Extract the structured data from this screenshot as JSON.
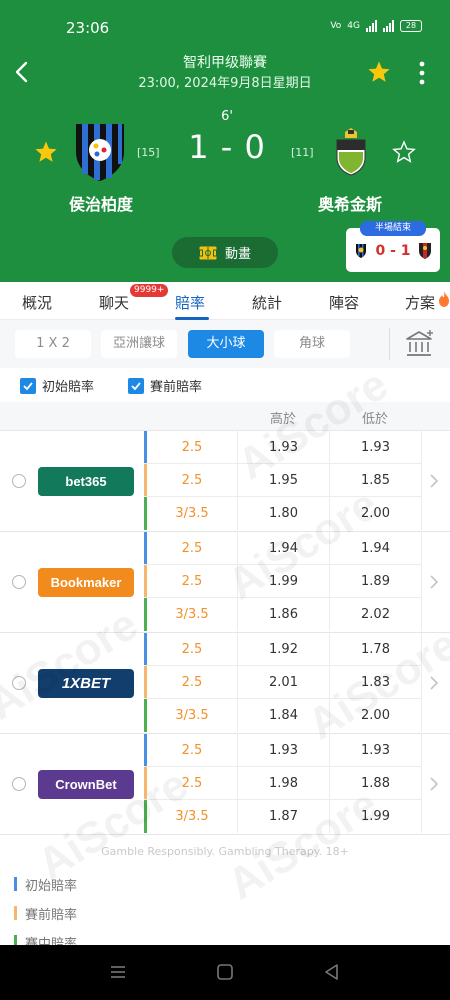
{
  "status_bar": {
    "time": "23:06",
    "network": "4G",
    "battery": "28"
  },
  "match": {
    "league": "智利甲级聯賽",
    "datetime": "23:00, 2024年9月8日星期日",
    "minute": "6'",
    "score": "1 - 0",
    "home": {
      "name": "侯治柏度",
      "rank": "[15]"
    },
    "away": {
      "name": "奥希金斯",
      "rank": "[11]"
    },
    "animation_label": "動畫",
    "half_time": {
      "tag": "半場結束",
      "score": "0 - 1"
    }
  },
  "tabs": [
    {
      "label": "概況"
    },
    {
      "label": "聊天",
      "badge": "9999+"
    },
    {
      "label": "賠率",
      "active": true
    },
    {
      "label": "統計"
    },
    {
      "label": "陣容"
    },
    {
      "label": "方案"
    }
  ],
  "filters": [
    {
      "label": "1 X 2"
    },
    {
      "label": "亞洲讓球"
    },
    {
      "label": "大小球",
      "active": true
    },
    {
      "label": "角球"
    }
  ],
  "checks": {
    "initial": "初始賠率",
    "prematch": "賽前賠率"
  },
  "table": {
    "headers": {
      "over": "高於",
      "under": "低於"
    },
    "bookmakers": [
      {
        "name": "bet365",
        "rows": [
          {
            "type": "initial",
            "line": "2.5",
            "over": "1.93",
            "under": "1.93"
          },
          {
            "type": "prematch",
            "line": "2.5",
            "over": "1.95",
            "under": "1.85"
          },
          {
            "type": "live",
            "line": "3/3.5",
            "over": "1.80",
            "under": "2.00"
          }
        ]
      },
      {
        "name": "Bookmaker",
        "rows": [
          {
            "type": "initial",
            "line": "2.5",
            "over": "1.94",
            "under": "1.94"
          },
          {
            "type": "prematch",
            "line": "2.5",
            "over": "1.99",
            "under": "1.89"
          },
          {
            "type": "live",
            "line": "3/3.5",
            "over": "1.86",
            "under": "2.02"
          }
        ]
      },
      {
        "name": "1XBET",
        "rows": [
          {
            "type": "initial",
            "line": "2.5",
            "over": "1.92",
            "under": "1.78"
          },
          {
            "type": "prematch",
            "line": "2.5",
            "over": "2.01",
            "under": "1.83"
          },
          {
            "type": "live",
            "line": "3/3.5",
            "over": "1.84",
            "under": "2.00"
          }
        ]
      },
      {
        "name": "CrownBet",
        "rows": [
          {
            "type": "initial",
            "line": "2.5",
            "over": "1.93",
            "under": "1.93"
          },
          {
            "type": "prematch",
            "line": "2.5",
            "over": "1.98",
            "under": "1.88"
          },
          {
            "type": "live",
            "line": "3/3.5",
            "over": "1.87",
            "under": "1.99"
          }
        ]
      }
    ]
  },
  "disclaimer": "Gamble Responsibly. Gambling Therapy. 18+",
  "legend": {
    "initial": "初始賠率",
    "prematch": "賽前賠率",
    "live": "賽中賠率"
  },
  "watermark": "AiScore",
  "colors": {
    "header_green": "#1d8f3e",
    "accent_blue": "#1e88e5",
    "odds_line_orange": "#f0932b",
    "initial_bar": "#4a90e2",
    "prematch_bar": "#f5b66e",
    "live_bar": "#4caf50",
    "score_red": "#d32f2f"
  }
}
